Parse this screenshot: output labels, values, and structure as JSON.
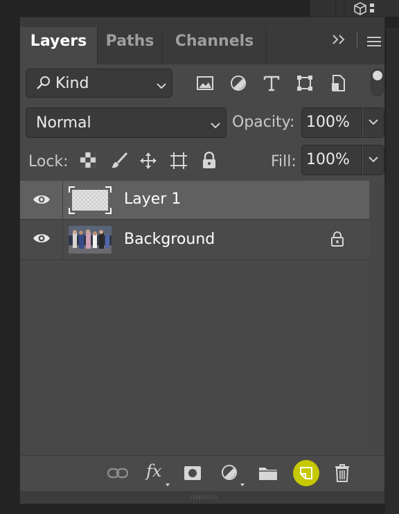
{
  "tabs": [
    {
      "label": "Layers",
      "active": true
    },
    {
      "label": "Paths",
      "active": false
    },
    {
      "label": "Channels",
      "active": false
    }
  ],
  "panel_controls": {
    "collapse_icon": "double-chevron-right-icon",
    "menu_icon": "hamburger-menu-icon"
  },
  "filter": {
    "kind_label": "Kind",
    "icons": [
      "image-filter-icon",
      "adjustment-filter-icon",
      "type-filter-icon",
      "shape-filter-icon",
      "smart-object-filter-icon"
    ],
    "toggle_on": true
  },
  "blend": {
    "mode": "Normal",
    "opacity_label": "Opacity:",
    "opacity_value": "100%"
  },
  "lock": {
    "label": "Lock:",
    "icons": [
      "lock-transparent-pixels-icon",
      "lock-image-pixels-icon",
      "lock-position-icon",
      "lock-artboard-icon",
      "lock-all-icon"
    ],
    "fill_label": "Fill:",
    "fill_value": "100%"
  },
  "layers": [
    {
      "name": "Layer 1",
      "visible": true,
      "selected": true,
      "locked": false,
      "thumbnail": "transparent"
    },
    {
      "name": "Background",
      "visible": true,
      "selected": false,
      "locked": true,
      "thumbnail": "photo-people-street"
    }
  ],
  "bottom_toolbar": {
    "icons": [
      "link-layers-icon",
      "fx-icon",
      "add-mask-icon",
      "adjustment-layer-icon",
      "group-folder-icon",
      "new-layer-icon",
      "delete-layer-icon"
    ],
    "fx_label": "fx",
    "highlight_color": "#c6c800"
  }
}
